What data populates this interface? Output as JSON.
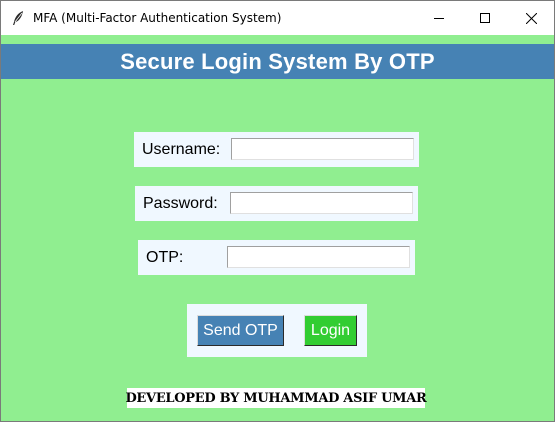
{
  "window": {
    "title": "MFA (Multi-Factor Authentication System)",
    "icon": "feather-icon",
    "controls": [
      "minimize-icon",
      "maximize-icon",
      "close-icon"
    ]
  },
  "header": {
    "title": "Secure Login System By OTP",
    "background": "#4682b4"
  },
  "form": {
    "username": {
      "label": "Username:",
      "value": ""
    },
    "password": {
      "label": "Password:",
      "value": ""
    },
    "otp": {
      "label": "OTP:",
      "value": ""
    }
  },
  "actions": {
    "send_otp_label": "Send OTP",
    "login_label": "Login"
  },
  "footer": {
    "text": "DEVELOPED BY MUHAMMAD ASIF UMAR"
  },
  "colors": {
    "window_background": "#90ee90",
    "panel_background": "#f0f8ff",
    "send_otp_button": "#4682b4",
    "login_button": "#32cd32"
  }
}
